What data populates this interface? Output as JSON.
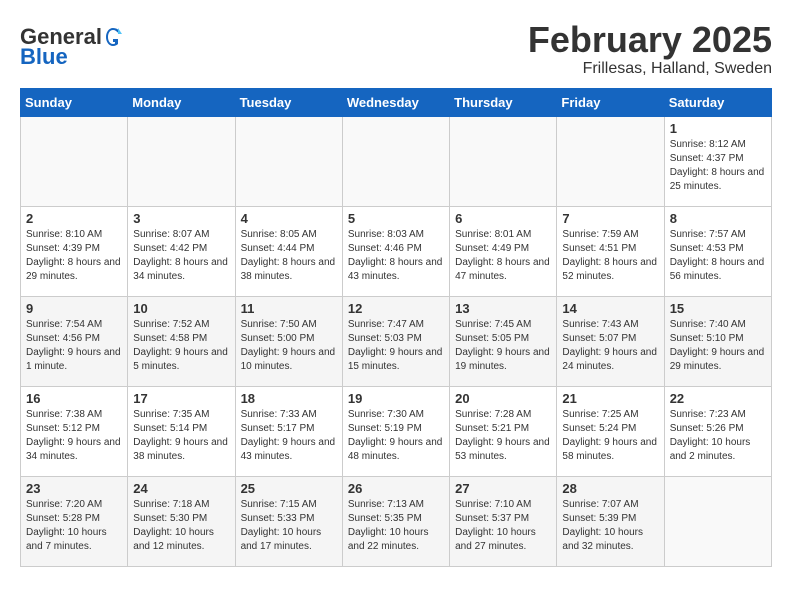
{
  "header": {
    "logo_general": "General",
    "logo_blue": "Blue",
    "title": "February 2025",
    "subtitle": "Frillesas, Halland, Sweden"
  },
  "calendar": {
    "weekdays": [
      "Sunday",
      "Monday",
      "Tuesday",
      "Wednesday",
      "Thursday",
      "Friday",
      "Saturday"
    ],
    "weeks": [
      [
        {
          "day": null
        },
        {
          "day": null
        },
        {
          "day": null
        },
        {
          "day": null
        },
        {
          "day": null
        },
        {
          "day": null
        },
        {
          "day": "1",
          "sunrise": "8:12 AM",
          "sunset": "4:37 PM",
          "daylight": "8 hours and 25 minutes."
        }
      ],
      [
        {
          "day": "2",
          "sunrise": "8:10 AM",
          "sunset": "4:39 PM",
          "daylight": "8 hours and 29 minutes."
        },
        {
          "day": "3",
          "sunrise": "8:07 AM",
          "sunset": "4:42 PM",
          "daylight": "8 hours and 34 minutes."
        },
        {
          "day": "4",
          "sunrise": "8:05 AM",
          "sunset": "4:44 PM",
          "daylight": "8 hours and 38 minutes."
        },
        {
          "day": "5",
          "sunrise": "8:03 AM",
          "sunset": "4:46 PM",
          "daylight": "8 hours and 43 minutes."
        },
        {
          "day": "6",
          "sunrise": "8:01 AM",
          "sunset": "4:49 PM",
          "daylight": "8 hours and 47 minutes."
        },
        {
          "day": "7",
          "sunrise": "7:59 AM",
          "sunset": "4:51 PM",
          "daylight": "8 hours and 52 minutes."
        },
        {
          "day": "8",
          "sunrise": "7:57 AM",
          "sunset": "4:53 PM",
          "daylight": "8 hours and 56 minutes."
        }
      ],
      [
        {
          "day": "9",
          "sunrise": "7:54 AM",
          "sunset": "4:56 PM",
          "daylight": "9 hours and 1 minute."
        },
        {
          "day": "10",
          "sunrise": "7:52 AM",
          "sunset": "4:58 PM",
          "daylight": "9 hours and 5 minutes."
        },
        {
          "day": "11",
          "sunrise": "7:50 AM",
          "sunset": "5:00 PM",
          "daylight": "9 hours and 10 minutes."
        },
        {
          "day": "12",
          "sunrise": "7:47 AM",
          "sunset": "5:03 PM",
          "daylight": "9 hours and 15 minutes."
        },
        {
          "day": "13",
          "sunrise": "7:45 AM",
          "sunset": "5:05 PM",
          "daylight": "9 hours and 19 minutes."
        },
        {
          "day": "14",
          "sunrise": "7:43 AM",
          "sunset": "5:07 PM",
          "daylight": "9 hours and 24 minutes."
        },
        {
          "day": "15",
          "sunrise": "7:40 AM",
          "sunset": "5:10 PM",
          "daylight": "9 hours and 29 minutes."
        }
      ],
      [
        {
          "day": "16",
          "sunrise": "7:38 AM",
          "sunset": "5:12 PM",
          "daylight": "9 hours and 34 minutes."
        },
        {
          "day": "17",
          "sunrise": "7:35 AM",
          "sunset": "5:14 PM",
          "daylight": "9 hours and 38 minutes."
        },
        {
          "day": "18",
          "sunrise": "7:33 AM",
          "sunset": "5:17 PM",
          "daylight": "9 hours and 43 minutes."
        },
        {
          "day": "19",
          "sunrise": "7:30 AM",
          "sunset": "5:19 PM",
          "daylight": "9 hours and 48 minutes."
        },
        {
          "day": "20",
          "sunrise": "7:28 AM",
          "sunset": "5:21 PM",
          "daylight": "9 hours and 53 minutes."
        },
        {
          "day": "21",
          "sunrise": "7:25 AM",
          "sunset": "5:24 PM",
          "daylight": "9 hours and 58 minutes."
        },
        {
          "day": "22",
          "sunrise": "7:23 AM",
          "sunset": "5:26 PM",
          "daylight": "10 hours and 2 minutes."
        }
      ],
      [
        {
          "day": "23",
          "sunrise": "7:20 AM",
          "sunset": "5:28 PM",
          "daylight": "10 hours and 7 minutes."
        },
        {
          "day": "24",
          "sunrise": "7:18 AM",
          "sunset": "5:30 PM",
          "daylight": "10 hours and 12 minutes."
        },
        {
          "day": "25",
          "sunrise": "7:15 AM",
          "sunset": "5:33 PM",
          "daylight": "10 hours and 17 minutes."
        },
        {
          "day": "26",
          "sunrise": "7:13 AM",
          "sunset": "5:35 PM",
          "daylight": "10 hours and 22 minutes."
        },
        {
          "day": "27",
          "sunrise": "7:10 AM",
          "sunset": "5:37 PM",
          "daylight": "10 hours and 27 minutes."
        },
        {
          "day": "28",
          "sunrise": "7:07 AM",
          "sunset": "5:39 PM",
          "daylight": "10 hours and 32 minutes."
        },
        {
          "day": null
        }
      ]
    ]
  }
}
